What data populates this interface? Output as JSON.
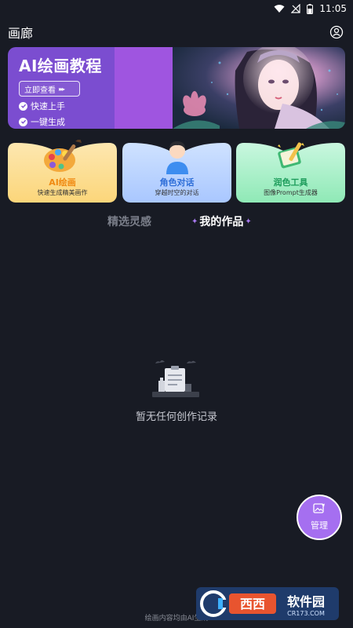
{
  "status_bar": {
    "time": "11:05"
  },
  "header": {
    "title": "画廊"
  },
  "banner": {
    "title": "AI绘画教程",
    "button_label": "立即查看",
    "features": [
      "快速上手",
      "一键生成"
    ]
  },
  "cards": [
    {
      "title": "AI绘画",
      "subtitle": "快速生成精美画作",
      "accent": "#f08a12",
      "icon": "palette-icon"
    },
    {
      "title": "角色对话",
      "subtitle": "穿越时空的对话",
      "accent": "#2f6fd8",
      "icon": "character-avatar-icon"
    },
    {
      "title": "润色工具",
      "subtitle": "图像Prompt生成器",
      "accent": "#1e9d5c",
      "icon": "book-pen-icon"
    }
  ],
  "tabs": [
    {
      "label": "精选灵感",
      "active": false
    },
    {
      "label": "我的作品",
      "active": true
    }
  ],
  "empty_state": {
    "text": "暂无任何创作记录"
  },
  "fab": {
    "label": "管理"
  },
  "footer": {
    "text": "绘画内容均由AI生成"
  },
  "watermark": {
    "brand": "西西软件园",
    "url": "CR173.COM"
  },
  "colors": {
    "background": "#181b24",
    "accent_purple": "#a56ff0",
    "banner_purple": "#7b4dd0"
  }
}
